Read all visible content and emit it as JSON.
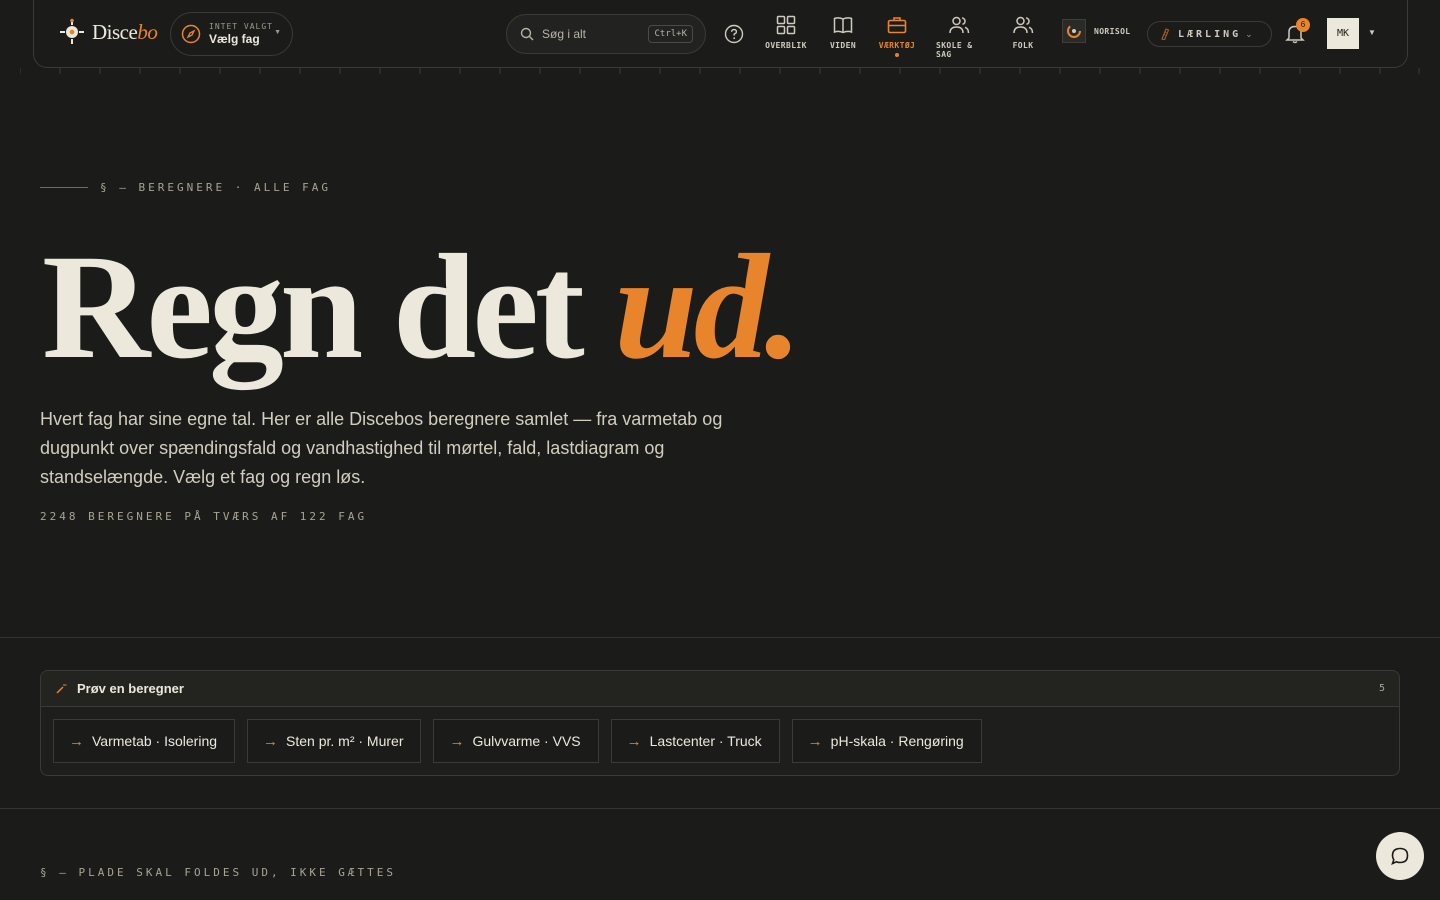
{
  "brand": {
    "name_main": "Disce",
    "name_accent": "bo"
  },
  "fag_picker": {
    "small_label": "INTET VALGT",
    "label": "Vælg fag"
  },
  "search": {
    "placeholder": "Søg i alt",
    "shortcut": "Ctrl+K"
  },
  "nav": {
    "items": [
      {
        "label": "OVERBLIK",
        "icon": "grid-icon"
      },
      {
        "label": "VIDEN",
        "icon": "book-icon"
      },
      {
        "label": "VÆRKTØJ",
        "icon": "toolbox-icon",
        "active": true
      },
      {
        "label": "SKOLE & SAG",
        "icon": "users-icon"
      },
      {
        "label": "FOLK",
        "icon": "people-icon"
      }
    ]
  },
  "org": {
    "name": "NORISOL"
  },
  "role": {
    "label": "LÆRLING"
  },
  "notifications": {
    "count": "6"
  },
  "user": {
    "initials": "MK"
  },
  "hero": {
    "eyebrow": "§ — BEREGNERE · ALLE FAG",
    "title_main": "Regn det ",
    "title_accent": "ud.",
    "lead": "Hvert fag har sine egne tal. Her er alle Discebos beregnere samlet — fra varmetab og dugpunkt over spændingsfald og vandhastighed til mørtel, fald, lastdiagram og standselængde. Vælg et fag og regn løs.",
    "count": "2248 BEREGNERE PÅ TVÆRS AF 122 FAG"
  },
  "try_panel": {
    "title": "Prøv en beregner",
    "count": "5",
    "chips": [
      "Varmetab · Isolering",
      "Sten pr. m² · Murer",
      "Gulvvarme · VVS",
      "Lastcenter · Truck",
      "pH-skala · Rengøring"
    ]
  },
  "section2": {
    "eyebrow": "§ — PLADE SKAL FOLDES UD, IKKE GÆTTES"
  },
  "colors": {
    "accent": "#e8842c",
    "background": "#1b1c1a",
    "text": "#ede8dc"
  }
}
